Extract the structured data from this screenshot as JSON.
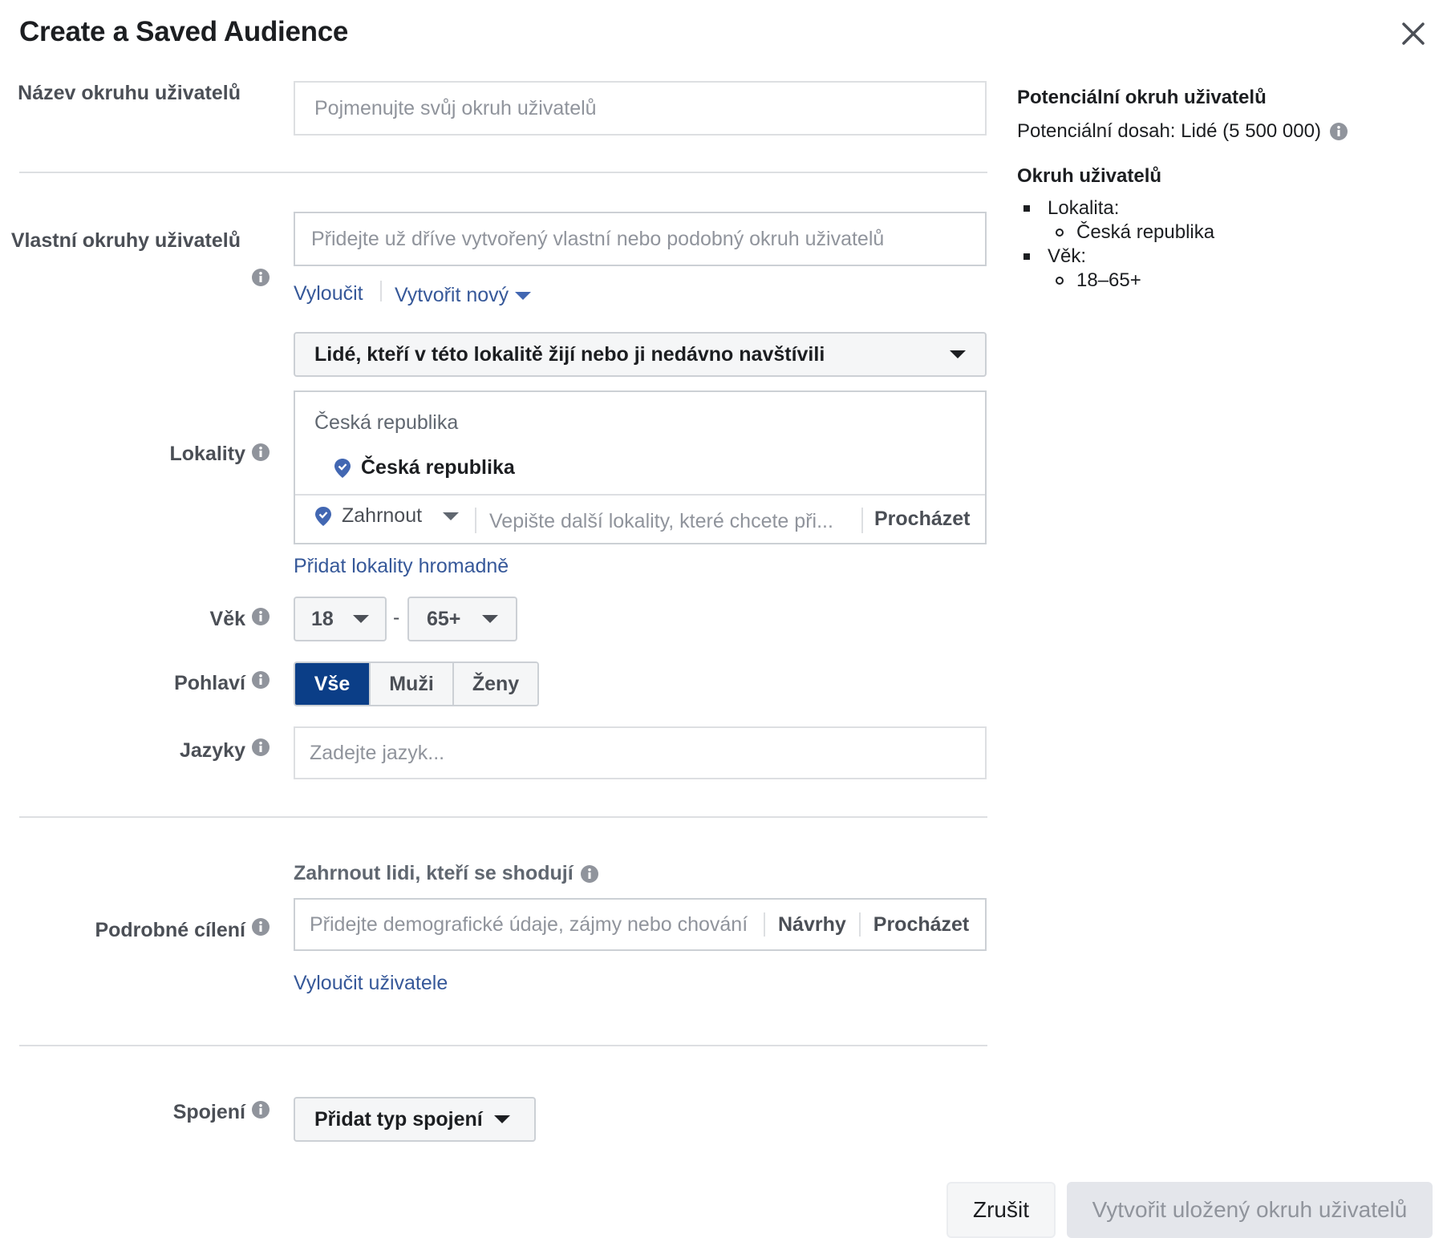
{
  "dialog": {
    "title": "Create a Saved Audience",
    "close_icon": "close-icon"
  },
  "name_row": {
    "label": "Název okruhu uživatelů",
    "placeholder": "Pojmenujte svůj okruh uživatelů",
    "value": ""
  },
  "custom_row": {
    "label": "Vlastní okruhy uživatelů",
    "placeholder": "Přidejte už dříve vytvořený vlastní nebo podobný okruh uživatelů",
    "exclude_link": "Vyloučit",
    "create_new_link": "Vytvořit nový"
  },
  "location_row": {
    "label": "Lokality",
    "type_select": "Lidé, kteří v této lokalitě žijí nebo ji nedávno navštívili",
    "group_label": "Česká republika",
    "selected_item": "Česká republika",
    "include_select": "Zahrnout",
    "search_placeholder": "Vepište další lokality, které chcete při...",
    "browse_button": "Procházet",
    "bulk_link": "Přidat lokality hromadně"
  },
  "age_row": {
    "label": "Věk",
    "min": "18",
    "separator": "-",
    "max": "65+"
  },
  "gender_row": {
    "label": "Pohlaví",
    "options": [
      "Vše",
      "Muži",
      "Ženy"
    ],
    "selected": "Vše"
  },
  "language_row": {
    "label": "Jazyky",
    "placeholder": "Zadejte jazyk..."
  },
  "detailed_row": {
    "label": "Podrobné cílení",
    "heading": "Zahrnout lidi, kteří se shodují",
    "placeholder": "Přidejte demografické údaje, zájmy nebo chování",
    "suggestions_button": "Návrhy",
    "browse_button": "Procházet",
    "exclude_link": "Vyloučit uživatele"
  },
  "connections_row": {
    "label": "Spojení",
    "button": "Přidat typ spojení"
  },
  "summary": {
    "potential_heading": "Potenciální okruh uživatelů",
    "reach_text": "Potenciální dosah: Lidé (5 500 000)",
    "audience_heading": "Okruh uživatelů",
    "items": [
      {
        "label": "Lokalita:",
        "value": "Česká republika"
      },
      {
        "label": "Věk:",
        "value": "18–65+"
      }
    ]
  },
  "footer": {
    "cancel": "Zrušit",
    "create": "Vytvořit uložený okruh uživatelů"
  },
  "colors": {
    "link": "#365899",
    "active_segment": "#0b3e87",
    "pin": "#4267b2"
  },
  "icons": {
    "info": "info-icon",
    "pin": "location-pin-icon",
    "caret": "caret-down-icon"
  }
}
